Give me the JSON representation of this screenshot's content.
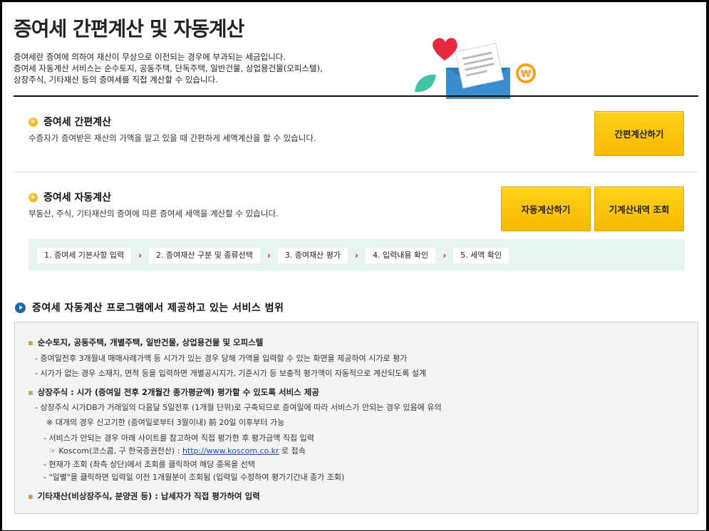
{
  "page": {
    "title": "증여세 간편계산 및 자동계산",
    "intro": [
      "증여세란 증여에 의하여 재산이 무상으로 이전되는 경우에 부과되는 세금입니다.",
      "증여세 자동계산 서비스는 순수토지, 공동주택, 단독주택, 일반건물, 상업용건물(오피스텔),",
      "상장주식, 기타재산 등의 증여세를 직접 계산할 수 있습니다."
    ]
  },
  "simple": {
    "title": "증여세 간편계산",
    "desc": "수증자가 증여받은 재산의 가액을 알고 있을 때 간편하게 세액계산을 할 수 있습니다.",
    "button": "간편계산하기"
  },
  "auto": {
    "title": "증여세 자동계산",
    "desc": "부동산, 주식, 기타재산의 증여에 따른 증여세 세액을 계산할 수 있습니다.",
    "button_auto": "자동계산하기",
    "button_history": "기계산내역 조회",
    "steps": [
      "1. 증여세 기본사항 입력",
      "2. 증여재산 구분 및 종류선택",
      "3. 증여재산 평가",
      "4. 입력내용 확인",
      "5. 세액 확인"
    ]
  },
  "services": {
    "heading": "증여세 자동계산 프로그램에서 제공하고 있는 서비스 범위",
    "item1_title": "순수토지, 공동주택, 개별주택, 일반건물, 상업용건물 및 오피스텔",
    "item1_line1": "- 증여일전후 3개월내 매매사례가액 등 시가가 있는 경우 당해 가액을 입력할 수 있는 화면을 제공하여 시가로 평가",
    "item1_line2": "- 시가가 없는 경우 소재지, 면적 등을 입력하면 개별공시지가, 기준시가 등 보충적 평가액이 자동적으로 계산되도록 설계",
    "item2_title": "상장주식 : 시가 (증여일 전후 2개월간 종가평균액) 평가할 수 있도록 서비스 제공",
    "item2_line1": "- 상장주식 시가DB가 거래일의 다음달 5일전후 (1개월 단위)로 구축되므로 증여일에 따라 서비스가 안되는 경우 있음에 유의",
    "item2_line2": "※ 대개의 경우 신고기한 (증여일로부터 3월이내) 前 20일 이후부터 가능",
    "item2_line3": "- 서비스가 안되는 경우 아래 사이트를 참고하여 직접 평가한 후 평가금액 직접 입력",
    "item2_link_prefix": "☞ Koscom(코스콤, 구 한국증권전산) :",
    "item2_link": "http://www.koscom.co.kr",
    "item2_link_suffix": "로 접속",
    "item2_line5": "- 현재가 조회 (좌측 상단)에서 조회를 클릭하여 해당 종목을 선택",
    "item2_line6": "- \"일별\"을 클릭하면 입력일 이전 1개월분이 조회됨 (입력일 수정하여 평가기간내 종가 조회)",
    "item3_title": "기타재산(비상장주식, 분양권 등) : 납세자가 직접 평가하여 입력",
    "bullet": "▪"
  },
  "colors": {
    "button_yellow": "#ffcc00",
    "steps_bg": "#e6f4f2",
    "arrow_red": "#c0272d",
    "link_blue": "#1a4fa0"
  }
}
